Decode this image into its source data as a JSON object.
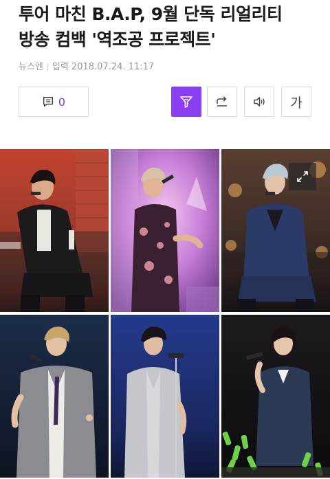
{
  "article": {
    "title_line1": "투어 마친 B.A.P, 9월 단독 리얼리티",
    "title_line2": "방송 컴백 '역조공 프로젝트'",
    "source": "뉴스엔",
    "published_label": "입력",
    "published_at": "2018.07.24. 11:17"
  },
  "toolbar": {
    "comment_count": "0",
    "font_size_label": "가",
    "accent_color": "#8b3ff2",
    "icons": [
      "comment-icon",
      "filter-icon",
      "share-icon",
      "speaker-icon",
      "font-size-icon"
    ]
  },
  "photos": {
    "count": 6,
    "expand_icon": "expand-icon"
  }
}
